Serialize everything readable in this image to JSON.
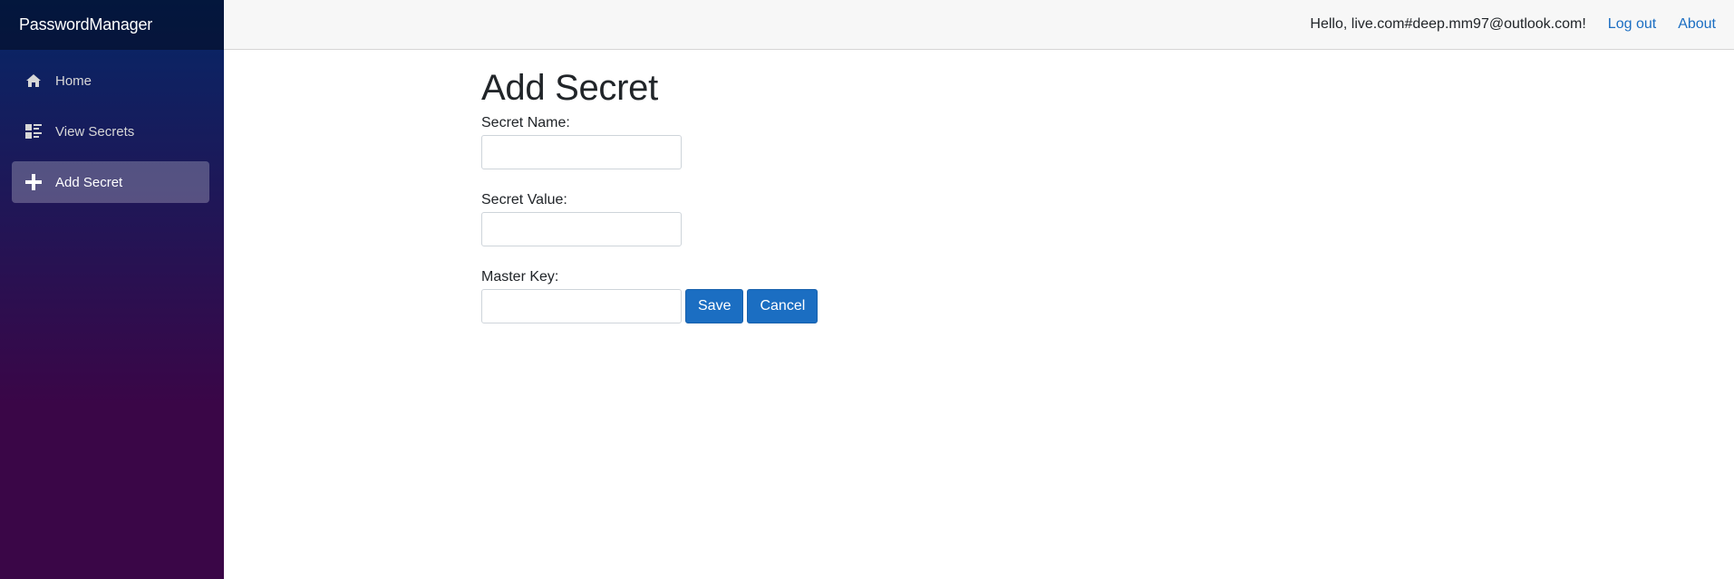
{
  "app": {
    "brand": "PasswordManager"
  },
  "sidebar": {
    "items": [
      {
        "label": "Home",
        "icon": "home-icon",
        "active": false
      },
      {
        "label": "View Secrets",
        "icon": "list-icon",
        "active": false
      },
      {
        "label": "Add Secret",
        "icon": "plus-icon",
        "active": true
      }
    ]
  },
  "header": {
    "greeting": "Hello, live.com#deep.mm97@outlook.com!",
    "logout_label": "Log out",
    "about_label": "About"
  },
  "form": {
    "title": "Add Secret",
    "secret_name_label": "Secret Name:",
    "secret_name_value": "",
    "secret_value_label": "Secret Value:",
    "secret_value_value": "",
    "master_key_label": "Master Key:",
    "master_key_value": "",
    "save_label": "Save",
    "cancel_label": "Cancel"
  },
  "colors": {
    "accent": "#1b6ec2",
    "sidebar_top": "#052767",
    "sidebar_bottom": "#3a0647"
  }
}
